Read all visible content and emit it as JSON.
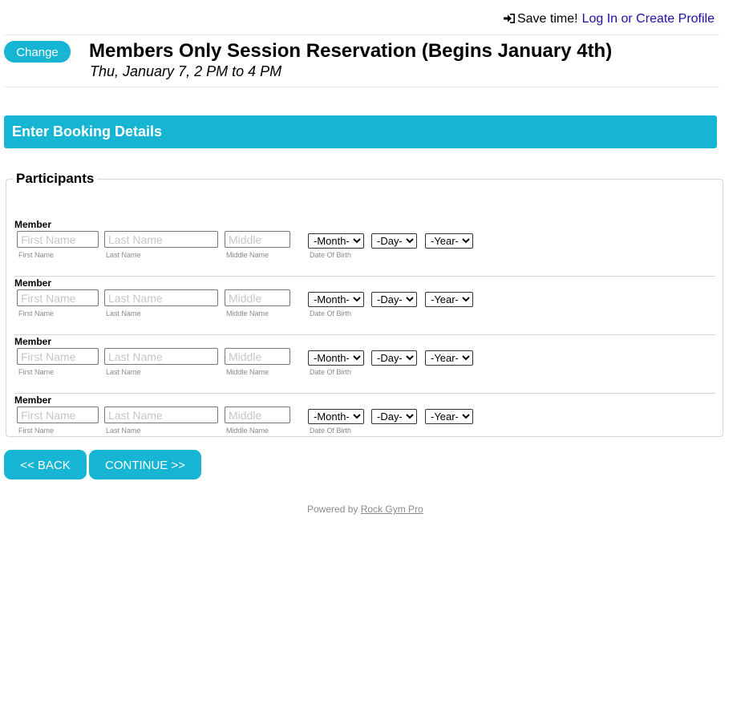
{
  "top_bar": {
    "save_time_label": "Save time!",
    "login_icon": "sign-in-icon",
    "login_link": "Log In or Create Profile",
    "link_color": "#1a0dab"
  },
  "session": {
    "change_button": "Change",
    "title": "Members Only Session Reservation (Begins January 4th)",
    "date": "Thu, January 7, 2 PM to 4 PM"
  },
  "section": {
    "title": "Enter Booking Details",
    "accent_color": "#17b5d4"
  },
  "participants": {
    "legend": "Participants",
    "rows": [
      {
        "label": "Member",
        "first_placeholder": "First Name",
        "last_placeholder": "Last Name",
        "middle_placeholder": "Middle",
        "month_selected": "-Month-",
        "day_selected": "-Day-",
        "year_selected": "-Year-",
        "first_caption": "First Name",
        "last_caption": "Last Name",
        "middle_caption": "Middle Name",
        "dob_caption": "Date Of Birth"
      },
      {
        "label": "Member",
        "first_placeholder": "First Name",
        "last_placeholder": "Last Name",
        "middle_placeholder": "Middle",
        "month_selected": "-Month-",
        "day_selected": "-Day-",
        "year_selected": "-Year-",
        "first_caption": "First Name",
        "last_caption": "Last Name",
        "middle_caption": "Middle Name",
        "dob_caption": "Date Of Birth"
      },
      {
        "label": "Member",
        "first_placeholder": "First Name",
        "last_placeholder": "Last Name",
        "middle_placeholder": "Middle",
        "month_selected": "-Month-",
        "day_selected": "-Day-",
        "year_selected": "-Year-",
        "first_caption": "First Name",
        "last_caption": "Last Name",
        "middle_caption": "Middle Name",
        "dob_caption": "Date Of Birth"
      },
      {
        "label": "Member",
        "first_placeholder": "First Name",
        "last_placeholder": "Last Name",
        "middle_placeholder": "Middle",
        "month_selected": "-Month-",
        "day_selected": "-Day-",
        "year_selected": "-Year-",
        "first_caption": "First Name",
        "last_caption": "Last Name",
        "middle_caption": "Middle Name",
        "dob_caption": "Date Of Birth"
      }
    ]
  },
  "actions": {
    "back": "<< BACK",
    "continue": "CONTINUE >>"
  },
  "footer": {
    "powered_by": "Powered by",
    "link": "Rock Gym Pro"
  }
}
